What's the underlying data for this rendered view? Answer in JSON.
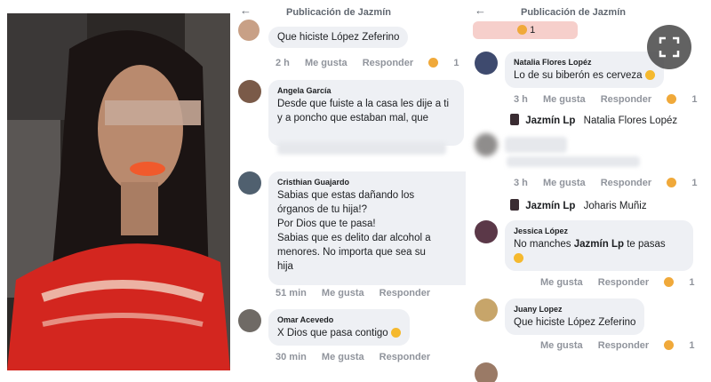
{
  "panels": {
    "header_title": "Publicación de Jazmín"
  },
  "mid": {
    "top_comment": {
      "text": "Que hiciste López Zeferino",
      "time": "2 h",
      "like": "Me gusta",
      "reply": "Responder",
      "count": "1"
    },
    "comments": [
      {
        "name": "Angela García",
        "text": "Desde que fuiste a la casa les dije a ti y a poncho que estaban mal, que"
      },
      {
        "name": "Cristhian Guajardo",
        "text1": "Sabias que estas dañando los",
        "text2": "órganos de tu hija!?",
        "text3": "Por Dios que te pasa!",
        "text4": "Sabias que es delito dar alcohol a",
        "text5": "menores. No importa que sea su",
        "text6": "hija",
        "time": "51 min",
        "like": "Me gusta",
        "reply": "Responder"
      },
      {
        "name": "Omar Acevedo",
        "text": "X Dios que pasa contigo",
        "time": "30 min",
        "like": "Me gusta",
        "reply": "Responder"
      }
    ]
  },
  "right": {
    "top_count": "1",
    "c1": {
      "name": "Natalia Flores Lopéz",
      "text": "Lo de su biberón es cerveza",
      "time": "3 h",
      "like": "Me gusta",
      "reply": "Responder",
      "count": "1"
    },
    "r1": {
      "author": "Jazmín Lp",
      "target": "Natalia Flores Lopéz"
    },
    "c2": {
      "text": "Lo dice cerveza lololololo",
      "time": "3 h",
      "like": "Me gusta",
      "reply": "Responder",
      "count": "1"
    },
    "r2": {
      "author": "Jazmín Lp",
      "target": "Joharis Muñiz"
    },
    "c3": {
      "name": "Jessica López",
      "text_a": "No manches",
      "mention": "Jazmín Lp",
      "text_b": "te pasas",
      "like": "Me gusta",
      "reply": "Responder",
      "count": "1"
    },
    "c4": {
      "name": "Juany Lopez",
      "text": "Que hiciste López Zeferino",
      "like": "Me gusta",
      "reply": "Responder",
      "count": "1"
    }
  },
  "colors": {
    "accent": "#e8c3c0",
    "bubble": "#eef0f4",
    "meta": "#90949c",
    "shirt": "#d3261f",
    "lips": "#f05a2c"
  },
  "icons": {
    "expand": "expand-icon",
    "back": "back-arrow-icon"
  }
}
